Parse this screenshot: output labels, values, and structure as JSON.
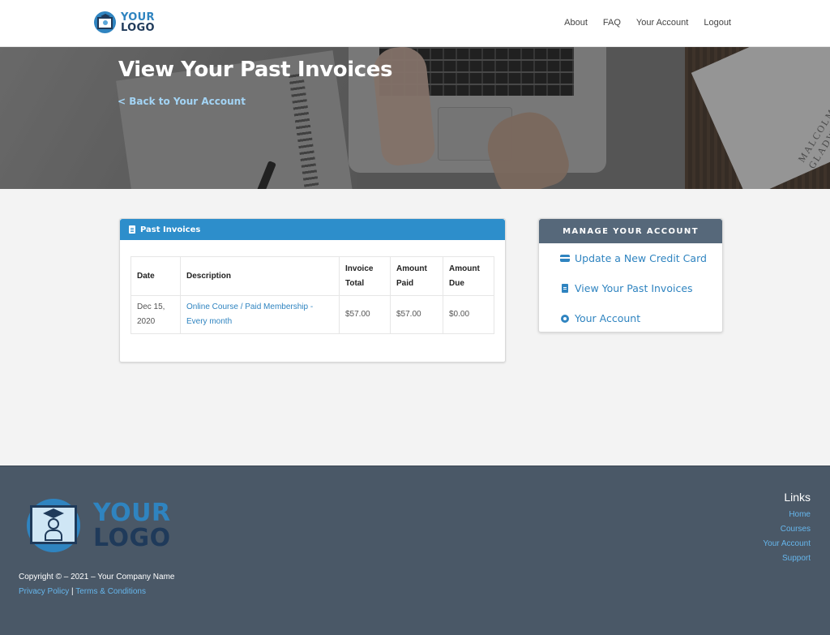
{
  "header": {
    "logo_line1": "YOUR",
    "logo_line2": "LOGO",
    "nav": [
      "About",
      "FAQ",
      "Your Account",
      "Logout"
    ]
  },
  "hero": {
    "title": "View Your Past Invoices",
    "back_link": "< Back to Your Account",
    "book_text": "MALCOLM GLADWELL"
  },
  "invoices": {
    "card_title": "Past Invoices",
    "columns": [
      "Date",
      "Description",
      "Invoice Total",
      "Amount Paid",
      "Amount Due"
    ],
    "rows": [
      {
        "date": "Dec 15, 2020",
        "description": "Online Course / Paid Membership - Every month",
        "invoice_total": "$57.00",
        "amount_paid": "$57.00",
        "amount_due": "$0.00"
      }
    ]
  },
  "account": {
    "title": "MANAGE YOUR ACCOUNT",
    "items": [
      {
        "label": "Update a New Credit Card",
        "icon": "credit-card-icon"
      },
      {
        "label": "View Your Past Invoices",
        "icon": "document-icon"
      },
      {
        "label": "Your Account",
        "icon": "gear-icon"
      }
    ]
  },
  "footer": {
    "logo_line1": "YOUR",
    "logo_line2": "LOGO",
    "copyright": "Copyright © – 2021 – Your Company Name",
    "privacy": "Privacy Policy",
    "separator": "|",
    "terms": "Terms & Conditions",
    "links_title": "Links",
    "links": [
      "Home",
      "Courses",
      "Your Account",
      "Support"
    ]
  },
  "colors": {
    "primary_blue": "#2d8ecb",
    "link_blue": "#2f84c0",
    "account_header": "#56687a",
    "footer_bg": "#4a5867",
    "footer_link": "#66b6ec"
  }
}
